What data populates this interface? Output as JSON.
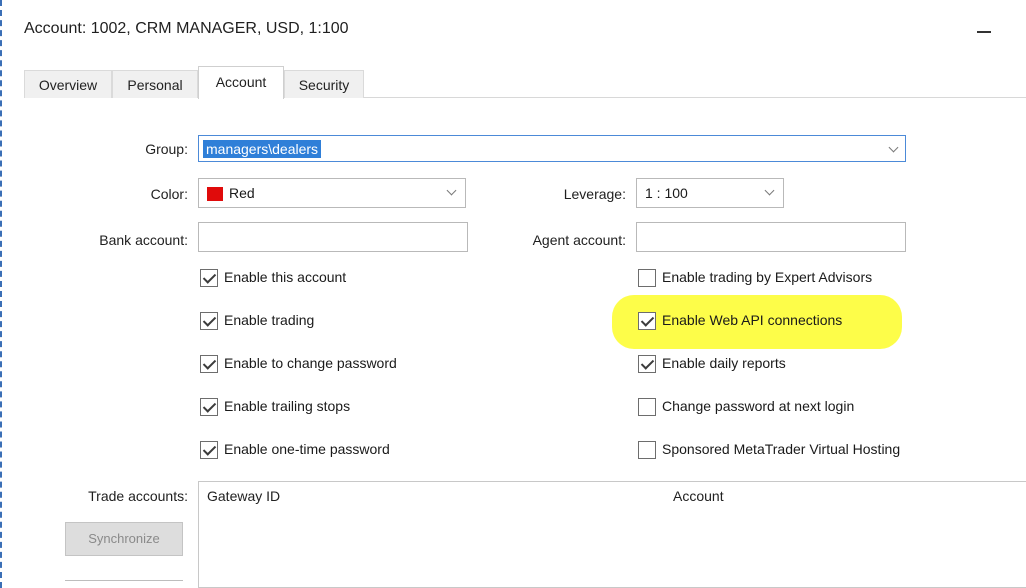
{
  "window": {
    "title": "Account: 1002, CRM MANAGER, USD, 1:100"
  },
  "tabs": [
    {
      "label": "Overview",
      "active": false
    },
    {
      "label": "Personal",
      "active": false
    },
    {
      "label": "Account",
      "active": true
    },
    {
      "label": "Security",
      "active": false
    }
  ],
  "form": {
    "group": {
      "label": "Group:",
      "value": "managers\\dealers"
    },
    "color": {
      "label": "Color:",
      "value": "Red",
      "swatch": "#e00b0b"
    },
    "leverage": {
      "label": "Leverage:",
      "value": "1 : 100"
    },
    "bank_account": {
      "label": "Bank account:",
      "value": ""
    },
    "agent_account": {
      "label": "Agent account:",
      "value": ""
    }
  },
  "checkboxes_left": [
    {
      "label": "Enable this account",
      "checked": true
    },
    {
      "label": "Enable trading",
      "checked": true
    },
    {
      "label": "Enable to change password",
      "checked": true
    },
    {
      "label": "Enable trailing stops",
      "checked": true
    },
    {
      "label": "Enable one-time password",
      "checked": true
    }
  ],
  "checkboxes_right": [
    {
      "label": "Enable trading by Expert Advisors",
      "checked": false
    },
    {
      "label": "Enable Web API connections",
      "checked": true
    },
    {
      "label": "Enable daily reports",
      "checked": true
    },
    {
      "label": "Change password at next login",
      "checked": false
    },
    {
      "label": "Sponsored MetaTrader Virtual Hosting",
      "checked": false
    }
  ],
  "trade_accounts": {
    "label": "Trade accounts:",
    "columns": [
      "Gateway ID",
      "Account"
    ],
    "synchronize_label": "Synchronize"
  },
  "colors": {
    "highlight": "#fdfd3a",
    "selection": "#2f7fd8"
  }
}
